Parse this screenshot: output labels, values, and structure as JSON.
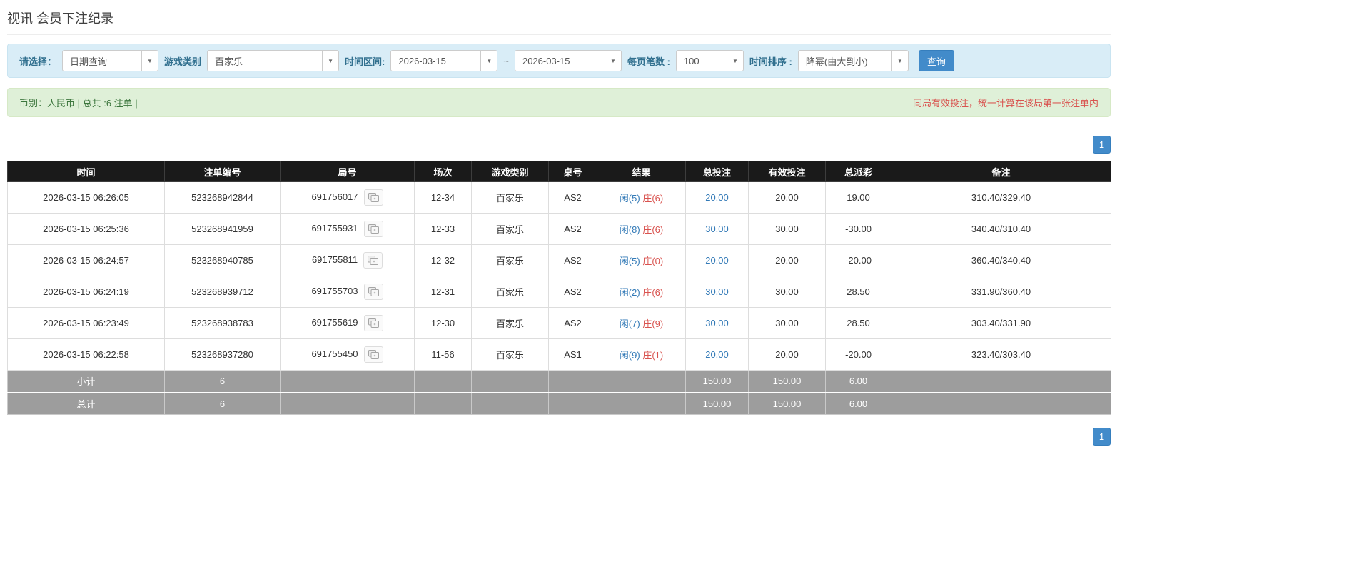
{
  "page": {
    "title": "视讯 会员下注纪录"
  },
  "filters": {
    "select_label": "请选择：",
    "select_value": "日期查询",
    "game_label": "游戏类别",
    "game_value": "百家乐",
    "range_label": "时间区间:",
    "date_from": "2026-03-15",
    "range_separator": "~",
    "date_to": "2026-03-15",
    "page_size_label": "每页笔数 :",
    "page_size_value": "100",
    "sort_label": "时间排序 :",
    "sort_value": "降幂(由大到小)",
    "search_button_label": "查询",
    "dropdown_caret": "▼"
  },
  "summary": {
    "left_text": "币别：人民币 | 总共 :6 注单 |",
    "right_text": "同局有效投注，统一计算在该局第一张注单内"
  },
  "pagination": {
    "current_page": "1"
  },
  "colors": {
    "accent_blue": "#428bca",
    "link_blue": "#337ab7",
    "player_blue": "#337ab7",
    "banker_red": "#d9534f",
    "negative_red": "#d9534f",
    "header_black": "#1a1a1a",
    "footer_gray": "#9d9d9d",
    "filter_bar_bg": "#d9edf7",
    "summary_bar_bg": "#dff0d8"
  },
  "table": {
    "headers": [
      "时间",
      "注单编号",
      "局号",
      "场次",
      "游戏类别",
      "桌号",
      "结果",
      "总投注",
      "有效投注",
      "总派彩",
      "备注"
    ],
    "rows": [
      {
        "time": "2026-03-15 06:26:05",
        "bet_id": "523268942844",
        "round": "691756017",
        "session": "12-34",
        "game": "百家乐",
        "table_no": "AS2",
        "result_player": "闲(5)",
        "result_banker": "庄(6)",
        "total_bet": "20.00",
        "valid_bet": "20.00",
        "payout": "19.00",
        "note": "310.40/329.40"
      },
      {
        "time": "2026-03-15 06:25:36",
        "bet_id": "523268941959",
        "round": "691755931",
        "session": "12-33",
        "game": "百家乐",
        "table_no": "AS2",
        "result_player": "闲(8)",
        "result_banker": "庄(6)",
        "total_bet": "30.00",
        "valid_bet": "30.00",
        "payout": "-30.00",
        "note": "340.40/310.40"
      },
      {
        "time": "2026-03-15 06:24:57",
        "bet_id": "523268940785",
        "round": "691755811",
        "session": "12-32",
        "game": "百家乐",
        "table_no": "AS2",
        "result_player": "闲(5)",
        "result_banker": "庄(0)",
        "total_bet": "20.00",
        "valid_bet": "20.00",
        "payout": "-20.00",
        "note": "360.40/340.40"
      },
      {
        "time": "2026-03-15 06:24:19",
        "bet_id": "523268939712",
        "round": "691755703",
        "session": "12-31",
        "game": "百家乐",
        "table_no": "AS2",
        "result_player": "闲(2)",
        "result_banker": "庄(6)",
        "total_bet": "30.00",
        "valid_bet": "30.00",
        "payout": "28.50",
        "note": "331.90/360.40"
      },
      {
        "time": "2026-03-15 06:23:49",
        "bet_id": "523268938783",
        "round": "691755619",
        "session": "12-30",
        "game": "百家乐",
        "table_no": "AS2",
        "result_player": "闲(7)",
        "result_banker": "庄(9)",
        "total_bet": "30.00",
        "valid_bet": "30.00",
        "payout": "28.50",
        "note": "303.40/331.90"
      },
      {
        "time": "2026-03-15 06:22:58",
        "bet_id": "523268937280",
        "round": "691755450",
        "session": "11-56",
        "game": "百家乐",
        "table_no": "AS1",
        "result_player": "闲(9)",
        "result_banker": "庄(1)",
        "total_bet": "20.00",
        "valid_bet": "20.00",
        "payout": "-20.00",
        "note": "323.40/303.40"
      }
    ],
    "footer": [
      {
        "label": "小计",
        "count": "6",
        "total_bet": "150.00",
        "valid_bet": "150.00",
        "payout": "6.00"
      },
      {
        "label": "总计",
        "count": "6",
        "total_bet": "150.00",
        "valid_bet": "150.00",
        "payout": "6.00"
      }
    ]
  }
}
